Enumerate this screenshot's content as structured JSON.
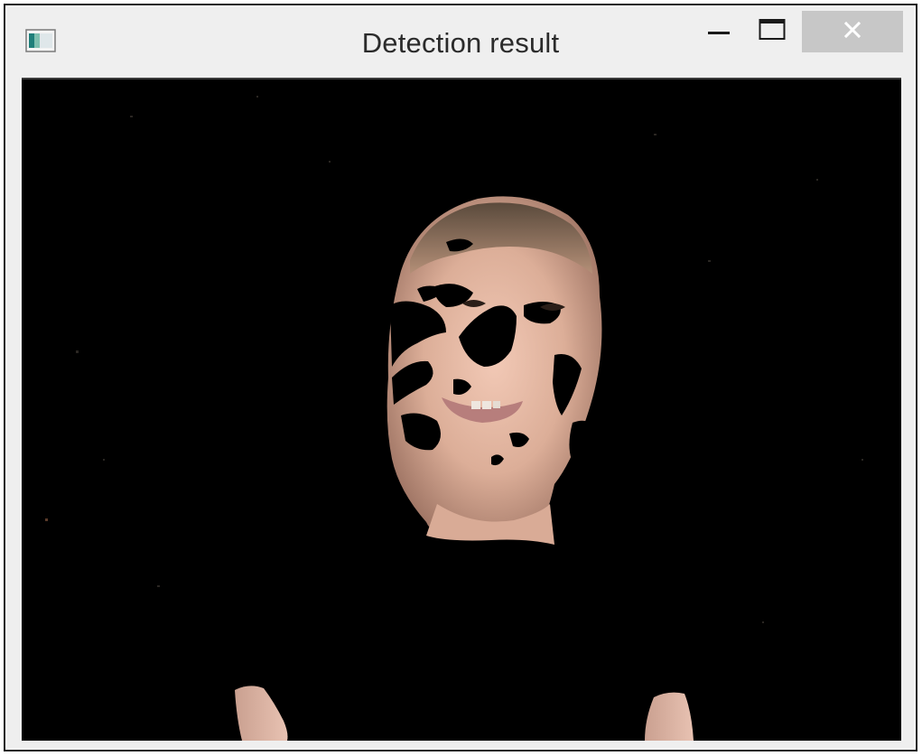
{
  "window": {
    "title": "Detection result",
    "controls": {
      "minimize_icon": "minimize-icon",
      "maximize_icon": "maximize-icon",
      "close_icon": "close-icon"
    },
    "close_button_color": "#c7c7c7",
    "titlebar_color": "#efefef"
  },
  "content": {
    "image_subject": "skin-detection mask of a smiling child's face on black background",
    "background_color": "#000000",
    "skin_tone_color": "#e3b7a4"
  }
}
